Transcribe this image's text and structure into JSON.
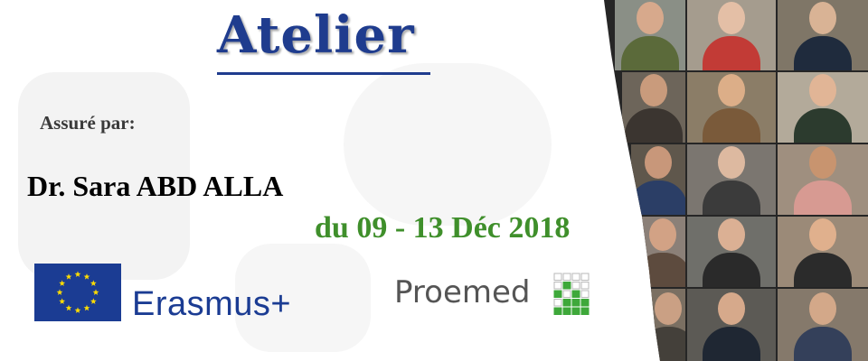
{
  "banner": {
    "title": "Atelier",
    "byline": "Assuré par:",
    "speaker": "Dr. Sara ABD ALLA",
    "dates": "du 09 - 13 Déc 2018"
  },
  "logos": {
    "eu_flag_icon": "eu-flag-icon",
    "erasmus_text": "Erasmus+",
    "proemed_text": "Proemed",
    "proemed_icon": "proemed-grid-icon"
  },
  "colors": {
    "title_blue": "#1f3c8e",
    "date_green": "#3f8f2b",
    "erasmus_blue": "#1b3c93",
    "proemed_green": "#3ea83a"
  }
}
